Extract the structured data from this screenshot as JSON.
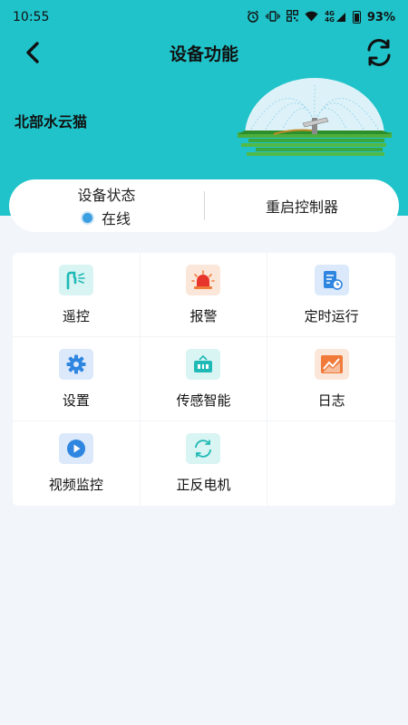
{
  "status_bar": {
    "time": "10:55",
    "signal_small": "4G",
    "battery": "93%"
  },
  "nav": {
    "title": "设备功能"
  },
  "device": {
    "name": "北部水云猫"
  },
  "status_card": {
    "label": "设备状态",
    "status": "在线",
    "restart": "重启控制器"
  },
  "functions": [
    {
      "label": "遥控",
      "icon": "remote-sprinkler-icon",
      "bg": "#d8f4f3"
    },
    {
      "label": "报警",
      "icon": "alarm-siren-icon",
      "bg": "#fbe7da"
    },
    {
      "label": "定时运行",
      "icon": "timer-schedule-icon",
      "bg": "#dbe9fb"
    },
    {
      "label": "设置",
      "icon": "gear-icon",
      "bg": "#dbe9fb"
    },
    {
      "label": "传感智能",
      "icon": "sensor-device-icon",
      "bg": "#d8f4f3"
    },
    {
      "label": "日志",
      "icon": "log-chart-icon",
      "bg": "#fbe7da"
    },
    {
      "label": "视频监控",
      "icon": "video-play-icon",
      "bg": "#dbe9fb"
    },
    {
      "label": "正反电机",
      "icon": "motor-cycle-icon",
      "bg": "#d8f4f3"
    }
  ],
  "colors": {
    "header": "#1fc3c9",
    "teal": "#1fbab5",
    "orange": "#f07a3a",
    "blue": "#2f86e0",
    "red": "#e8352b"
  }
}
